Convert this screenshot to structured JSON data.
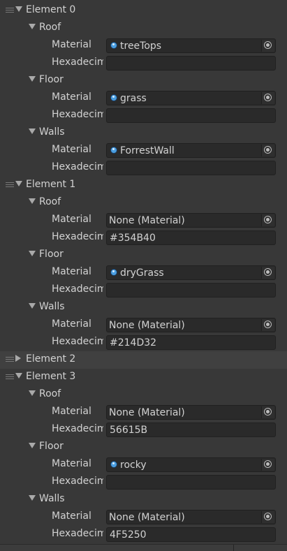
{
  "elements": [
    {
      "label": "Element 0",
      "expanded": true,
      "highlighted": false,
      "sections": [
        {
          "label": "Roof",
          "material": {
            "label": "Material",
            "value": "treeTops",
            "has_icon": true
          },
          "hex": {
            "label": "Hexadecimal",
            "value": ""
          }
        },
        {
          "label": "Floor",
          "material": {
            "label": "Material",
            "value": "grass",
            "has_icon": true
          },
          "hex": {
            "label": "Hexadecimal",
            "value": ""
          }
        },
        {
          "label": "Walls",
          "material": {
            "label": "Material",
            "value": "ForrestWall",
            "has_icon": true
          },
          "hex": {
            "label": "Hexadecimal",
            "value": ""
          }
        }
      ]
    },
    {
      "label": "Element 1",
      "expanded": true,
      "highlighted": false,
      "sections": [
        {
          "label": "Roof",
          "material": {
            "label": "Material",
            "value": "None (Material)",
            "has_icon": false
          },
          "hex": {
            "label": "Hexadecimal",
            "value": "#354B40"
          }
        },
        {
          "label": "Floor",
          "material": {
            "label": "Material",
            "value": "dryGrass",
            "has_icon": true
          },
          "hex": {
            "label": "Hexadecimal",
            "value": ""
          }
        },
        {
          "label": "Walls",
          "material": {
            "label": "Material",
            "value": "None (Material)",
            "has_icon": false
          },
          "hex": {
            "label": "Hexadecimal",
            "value": "#214D32"
          }
        }
      ]
    },
    {
      "label": "Element 2",
      "expanded": false,
      "highlighted": true,
      "sections": []
    },
    {
      "label": "Element 3",
      "expanded": true,
      "highlighted": false,
      "sections": [
        {
          "label": "Roof",
          "material": {
            "label": "Material",
            "value": "None (Material)",
            "has_icon": false
          },
          "hex": {
            "label": "Hexadecimal",
            "value": "56615B"
          }
        },
        {
          "label": "Floor",
          "material": {
            "label": "Material",
            "value": "rocky",
            "has_icon": true
          },
          "hex": {
            "label": "Hexadecimal",
            "value": ""
          }
        },
        {
          "label": "Walls",
          "material": {
            "label": "Material",
            "value": "None (Material)",
            "has_icon": false
          },
          "hex": {
            "label": "Hexadecimal",
            "value": "4F5250"
          }
        }
      ]
    }
  ],
  "colors": {
    "panel_background": "#383838",
    "field_background": "#2a2a2a",
    "highlight_row": "#404040",
    "material_icon": "#4a9ee0",
    "text": "#d2d2d2"
  }
}
